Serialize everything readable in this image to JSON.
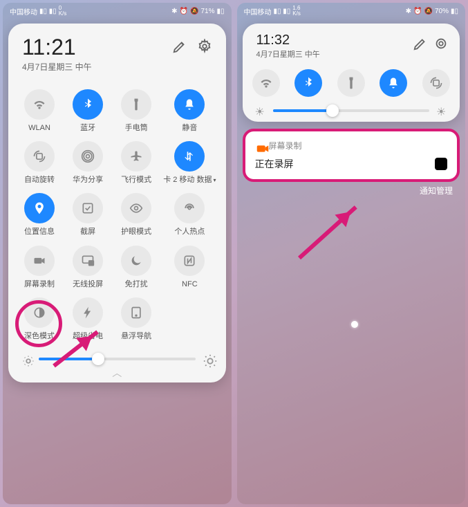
{
  "left": {
    "statusbar": {
      "carrier": "中国移动",
      "speed": "0\nK/s",
      "right": "71%"
    },
    "clock": {
      "time": "11:21",
      "date": "4月7日星期三 中午"
    },
    "tiles": [
      {
        "id": "wlan",
        "label": "WLAN",
        "icon": "wifi",
        "active": false
      },
      {
        "id": "bluetooth",
        "label": "蓝牙",
        "icon": "bluetooth",
        "active": true
      },
      {
        "id": "flashlight",
        "label": "手电筒",
        "icon": "flashlight",
        "active": false
      },
      {
        "id": "mute",
        "label": "静音",
        "icon": "bell-off",
        "active": true
      },
      {
        "id": "rotate",
        "label": "自动旋转",
        "icon": "rotate",
        "active": false
      },
      {
        "id": "huawei-share",
        "label": "华为分享",
        "icon": "share",
        "active": false
      },
      {
        "id": "airplane",
        "label": "飞行模式",
        "icon": "plane",
        "active": false
      },
      {
        "id": "data",
        "label": "卡 2 移动\n数据",
        "icon": "data",
        "active": true,
        "chevron": true
      },
      {
        "id": "location",
        "label": "位置信息",
        "icon": "pin",
        "active": true
      },
      {
        "id": "screenshot",
        "label": "截屏",
        "icon": "screenshot",
        "active": false
      },
      {
        "id": "eye",
        "label": "护眼模式",
        "icon": "eye",
        "active": false
      },
      {
        "id": "hotspot",
        "label": "个人热点",
        "icon": "hotspot",
        "active": false
      },
      {
        "id": "screen-record",
        "label": "屏幕录制",
        "icon": "record",
        "active": false
      },
      {
        "id": "cast",
        "label": "无线投屏",
        "icon": "cast",
        "active": false
      },
      {
        "id": "dnd",
        "label": "免打扰",
        "icon": "moon",
        "active": false
      },
      {
        "id": "nfc",
        "label": "NFC",
        "icon": "nfc",
        "active": false
      },
      {
        "id": "dark",
        "label": "深色模式",
        "icon": "dark",
        "active": false
      },
      {
        "id": "battery-saver",
        "label": "超级省电",
        "icon": "bolt",
        "active": false
      },
      {
        "id": "float-nav",
        "label": "悬浮导航",
        "icon": "float",
        "active": false
      }
    ],
    "brightness": 38,
    "highlight_tile": "screen-record"
  },
  "right": {
    "statusbar": {
      "carrier": "中国移动",
      "speed": "1.6\nK/s",
      "right": "70%"
    },
    "clock": {
      "time": "11:32",
      "date": "4月7日星期三 中午"
    },
    "tiles": [
      {
        "id": "wlan",
        "icon": "wifi",
        "active": false
      },
      {
        "id": "bluetooth",
        "icon": "bluetooth",
        "active": true
      },
      {
        "id": "flashlight",
        "icon": "flashlight",
        "active": false
      },
      {
        "id": "mute",
        "icon": "bell-off",
        "active": true
      },
      {
        "id": "rotate",
        "icon": "rotate",
        "active": false
      }
    ],
    "brightness": 38,
    "notification": {
      "app_name": "屏幕录制",
      "title": "正在录屏"
    },
    "footer": "通知管理"
  }
}
